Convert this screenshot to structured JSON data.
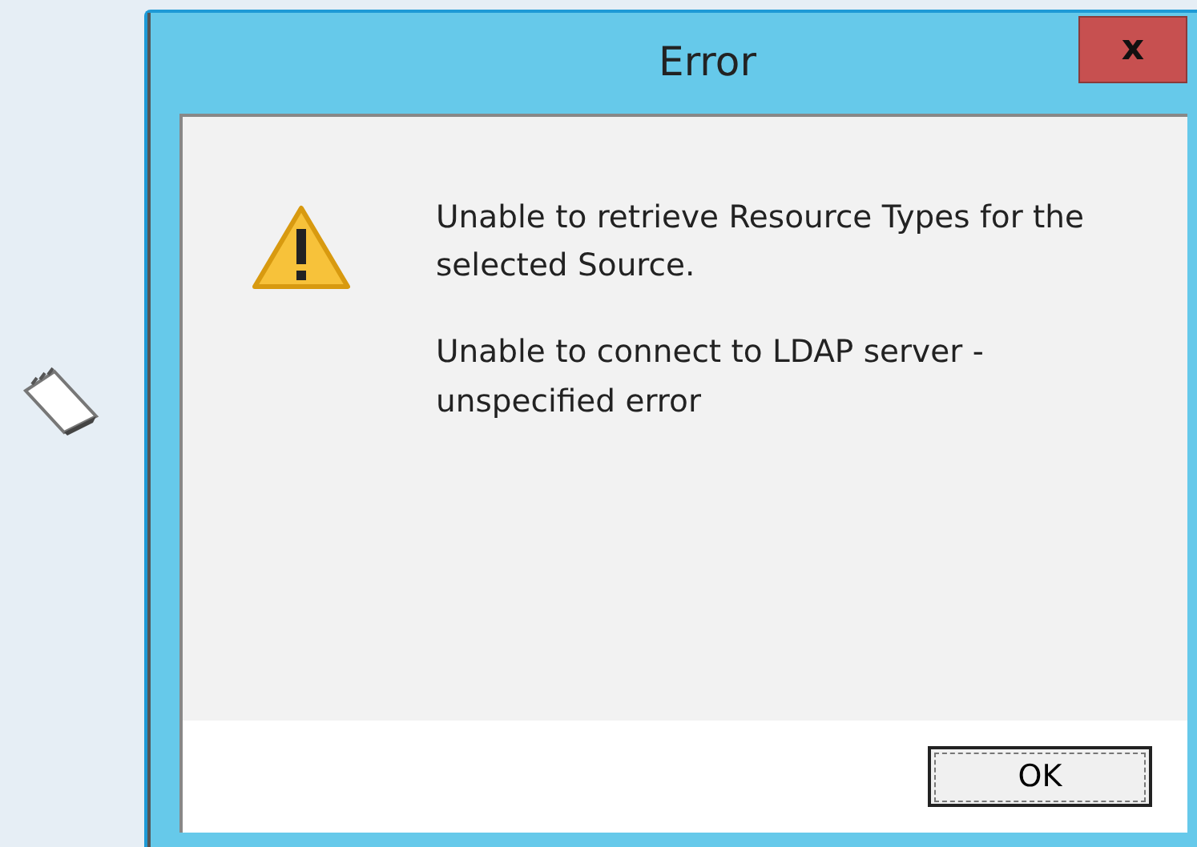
{
  "window": {
    "title": "Error"
  },
  "messages": [
    "Unable to retrieve Resource Types for the selected Source.",
    "Unable to connect to LDAP server - unspecified error"
  ],
  "close_button": "x",
  "buttons": [
    {
      "label": "OK",
      "focused": true
    }
  ]
}
